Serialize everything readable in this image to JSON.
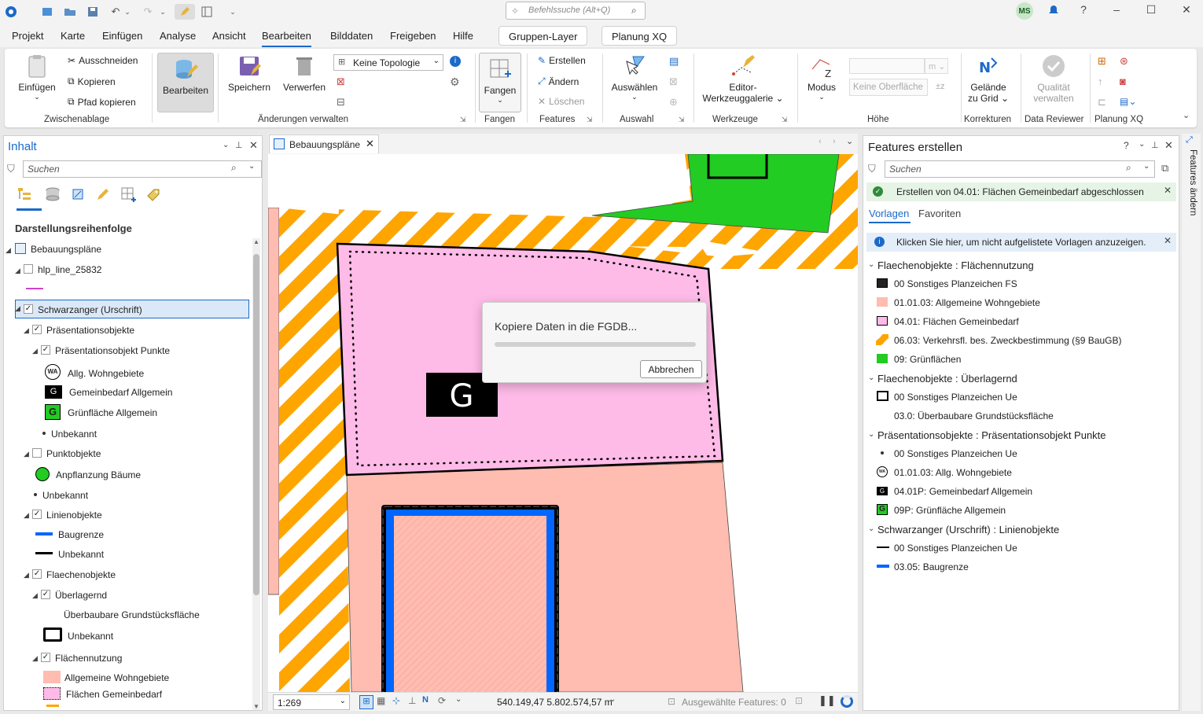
{
  "titlebar": {
    "search_placeholder": "Befehlssuche (Alt+Q)",
    "user_initials": "MS"
  },
  "menu": {
    "items": [
      "Projekt",
      "Karte",
      "Einfügen",
      "Analyse",
      "Ansicht",
      "Bearbeiten",
      "Bilddaten",
      "Freigeben",
      "Hilfe"
    ],
    "context_tabs": [
      "Gruppen-Layer",
      "Planung XQ"
    ]
  },
  "ribbon": {
    "clipboard": {
      "paste": "Einfügen",
      "cut": "Ausschneiden",
      "copy": "Kopieren",
      "copy_path": "Pfad kopieren",
      "label": "Zwischenablage"
    },
    "edit": {
      "label": "Bearbeiten"
    },
    "manage": {
      "save": "Speichern",
      "discard": "Verwerfen",
      "topology": "Keine Topologie",
      "label": "Änderungen verwalten"
    },
    "snapping": {
      "snap": "Fangen",
      "label": "Fangen"
    },
    "features": {
      "create": "Erstellen",
      "modify": "Ändern",
      "delete": "Löschen",
      "label": "Features"
    },
    "selection": {
      "select": "Auswählen",
      "label": "Auswahl"
    },
    "tools": {
      "gallery_line1": "Editor-",
      "gallery_line2": "Werkzeuggalerie",
      "label": "Werkzeuge"
    },
    "elevation": {
      "mode": "Modus",
      "unit": "m",
      "surface": "Keine Oberfläche",
      "label": "Höhe"
    },
    "corrections": {
      "ground_line1": "Gelände",
      "ground_line2": "zu Grid",
      "label": "Korrekturen"
    },
    "reviewer": {
      "quality_line1": "Qualität",
      "quality_line2": "verwalten",
      "label": "Data Reviewer"
    },
    "planung": {
      "label": "Planung XQ"
    }
  },
  "contents": {
    "title": "Inhalt",
    "search_placeholder": "Suchen",
    "heading": "Darstellungsreihenfolge",
    "tree": {
      "map": "Bebauungspläne",
      "hlp": "hlp_line_25832",
      "schwarz": "Schwarzanger (Urschrift)",
      "praes": "Präsentationsobjekte",
      "praes_pkt": "Präsentationsobjekt Punkte",
      "wa": "Allg. Wohngebiete",
      "gem": "Gemeinbedarf Allgemein",
      "gruen": "Grünfläche Allgemein",
      "unb1": "Unbekannt",
      "punkt": "Punktobjekte",
      "baeume": "Anpflanzung Bäume",
      "unb2": "Unbekannt",
      "linie": "Linienobjekte",
      "baugrenze": "Baugrenze",
      "unb3": "Unbekannt",
      "flaeche": "Flaechenobjekte",
      "ueber": "Überlagernd",
      "ueberbau": "Überbaubare Grundstücksfläche",
      "unb4": "Unbekannt",
      "flnutz": "Flächennutzung",
      "allg_wohn": "Allgemeine Wohngebiete",
      "fl_gem": "Flächen Gemeinbedarf"
    },
    "sym_wa": "WA",
    "sym_g": "G"
  },
  "map": {
    "tab": "Bebauungspläne",
    "label_g": "G",
    "scale": "1:269",
    "coords": "540.149,47 5.802.574,57 m",
    "selected": "Ausgewählte Features: 0"
  },
  "dialog": {
    "message": "Kopiere Daten in die FGDB...",
    "cancel": "Abbrechen",
    "progress": 0.0
  },
  "create": {
    "title": "Features erstellen",
    "search_placeholder": "Suchen",
    "success": "Erstellen von 04.01: Flächen Gemeinbedarf abgeschlossen",
    "tabs": [
      "Vorlagen",
      "Favoriten"
    ],
    "info": "Klicken Sie hier, um nicht aufgelistete Vorlagen anzuzeigen.",
    "side_tab": "Features ändern",
    "groups": [
      {
        "header": "Flaechenobjekte : Flächennutzung",
        "items": [
          "00 Sonstiges Planzeichen FS",
          "01.01.03: Allgemeine Wohngebiete",
          "04.01: Flächen Gemeinbedarf",
          "06.03: Verkehrsfl. bes. Zweckbestimmung (§9 BauGB)",
          "09: Grünflächen"
        ]
      },
      {
        "header": "Flaechenobjekte : Überlagernd",
        "items": [
          "00 Sonstiges Planzeichen Ue",
          "03.0: Überbaubare Grundstücksfläche"
        ]
      },
      {
        "header": "Präsentationsobjekte : Präsentationsobjekt Punkte",
        "items": [
          "00 Sonstiges Planzeichen Ue",
          "01.01.03: Allg. Wohngebiete",
          "04.01P: Gemeinbedarf Allgemein",
          "09P: Grünfläche Allgemein"
        ]
      },
      {
        "header": "Schwarzanger (Urschrift) : Linienobjekte",
        "items": [
          "00 Sonstiges Planzeichen Ue",
          "03.05: Baugrenze"
        ]
      }
    ],
    "sym_wa": "WA",
    "sym_g": "G"
  },
  "colors": {
    "accent": "#1b6ac9",
    "green": "#22cc22",
    "pink": "#ffbbe8",
    "salmon": "#ffbcb0",
    "orange": "#ffa500",
    "blue": "#0066ff"
  }
}
